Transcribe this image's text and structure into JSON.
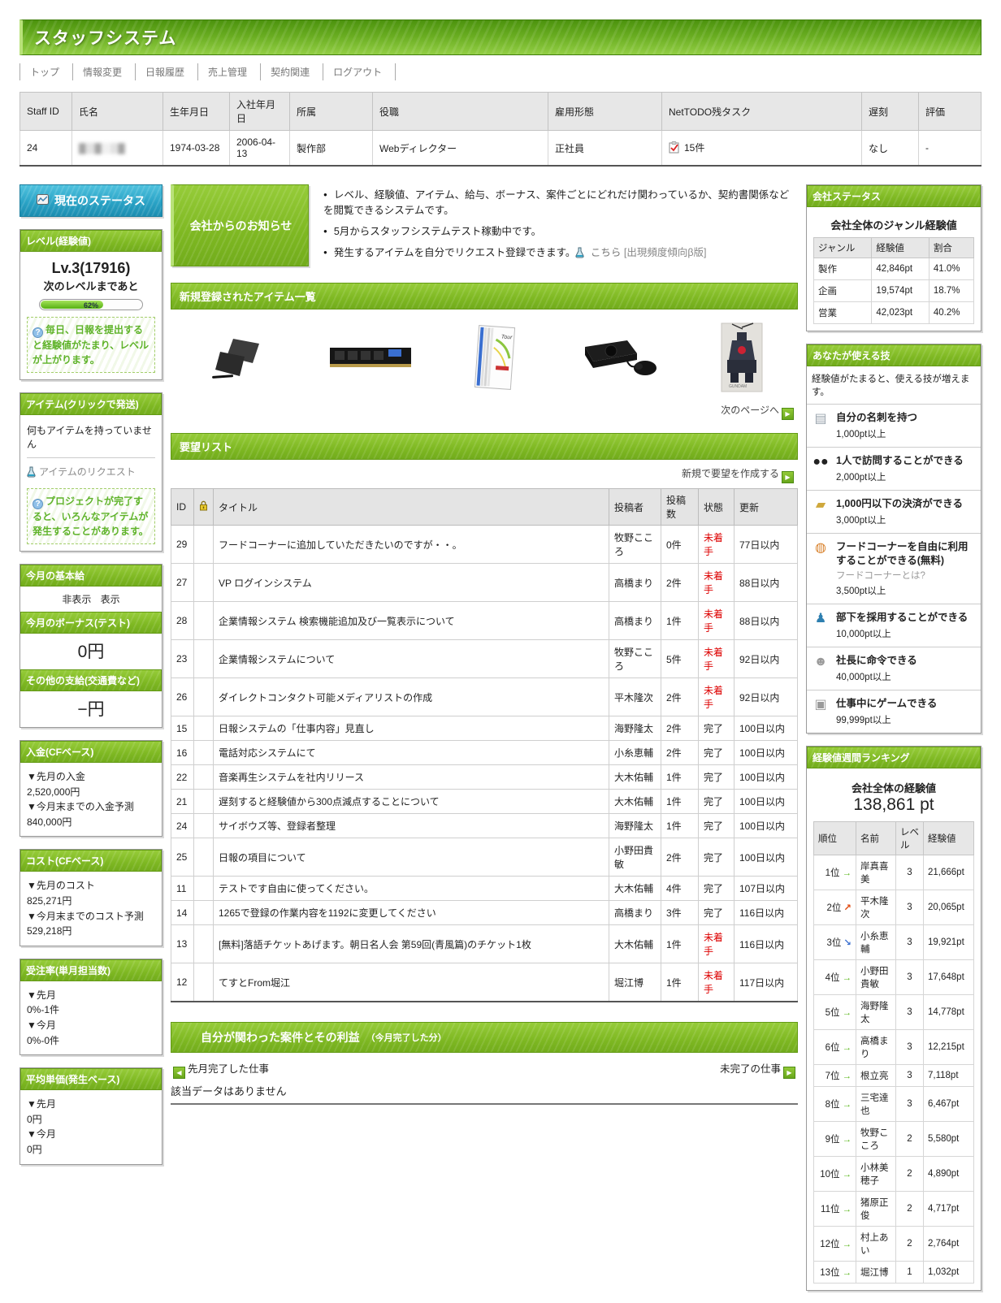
{
  "colors": {
    "accent_green": "#7eb822",
    "accent_blue": "#2aa3c6",
    "alert_red": "#dd0000"
  },
  "header": {
    "title": "スタッフシステム"
  },
  "nav": {
    "items": [
      "トップ",
      "情報変更",
      "日報履歴",
      "売上管理",
      "契約関連",
      "ログアウト"
    ]
  },
  "staff": {
    "headers": [
      "Staff ID",
      "氏名",
      "生年月日",
      "入社年月日",
      "所属",
      "役職",
      "雇用形態",
      "NetTODO残タスク",
      "遅刻",
      "評価"
    ],
    "row": {
      "staff_id": "24",
      "name_censored": "▓▒▓░▒▓",
      "birth": "1974-03-28",
      "join": "2006-04-13",
      "dept": "製作部",
      "role": "Webディレクター",
      "employment": "正社員",
      "nettodo": "15件",
      "late": "なし",
      "rating": "-"
    }
  },
  "status_button": {
    "label": "現在のステータス"
  },
  "level_box": {
    "title": "レベル(経験値)",
    "level": "Lv.3(17916)",
    "next_label": "次のレベルまであと",
    "progress_percent": 62,
    "progress_label": "62%",
    "hint": "毎日、日報を提出すると経験値がたまり、レベルが上がります。"
  },
  "item_box": {
    "title": "アイテム(クリックで発送)",
    "empty": "何もアイテムを持っていません",
    "request_link": "アイテムのリクエスト",
    "hint": "プロジェクトが完了すると、いろんなアイテムが発生することがあります。"
  },
  "salary_box": {
    "base_title": "今月の基本給",
    "hide_label": "非表示",
    "show_label": "表示",
    "bonus_title": "今月のボーナス(テスト)",
    "bonus_value": "0円",
    "other_title": "その他の支給(交通費など)",
    "other_value": "−円"
  },
  "income_box": {
    "title": "入金(CFベース)",
    "lines": [
      {
        "label": "▼先月の入金",
        "value": "2,520,000円"
      },
      {
        "label": "▼今月末までの入金予測",
        "value": "840,000円"
      }
    ]
  },
  "cost_box": {
    "title": "コスト(CFベース)",
    "lines": [
      {
        "label": "▼先月のコスト",
        "value": "825,271円"
      },
      {
        "label": "▼今月末までのコスト予測",
        "value": "529,218円"
      }
    ]
  },
  "order_box": {
    "title": "受注率(単月担当数)",
    "lines": [
      {
        "label": "▼先月",
        "value": "0%-1件"
      },
      {
        "label": "▼今月",
        "value": "0%-0件"
      }
    ]
  },
  "avg_box": {
    "title": "平均単価(発生ベース)",
    "lines": [
      {
        "label": "▼先月",
        "value": "0円"
      },
      {
        "label": "▼今月",
        "value": "0円"
      }
    ]
  },
  "announcements": {
    "button_label": "会社からのお知らせ",
    "items": [
      {
        "text": "レベル、経験値、アイテム、給与、ボーナス、案件ごとにどれだけ関わっているか、契約書関係などを閲覧できるシステムです。"
      },
      {
        "text": "5月からスタッフシステムテスト稼動中です。"
      },
      {
        "text": "発生するアイテムを自分でリクエスト登録できます。",
        "has_flask": true,
        "link": "こちら",
        "suffix": "[出現頻度傾向β版]"
      }
    ]
  },
  "new_items": {
    "title": "新規登録されたアイテム一覧",
    "images": [
      "pen-tablet",
      "memory-module",
      "dvd-boxset",
      "game-console",
      "robot-model"
    ],
    "next_label": "次のページへ"
  },
  "wishlist": {
    "title": "要望リスト",
    "create_label": "新規で要望を作成する",
    "headers": {
      "id": "ID",
      "title": "タイトル",
      "poster": "投稿者",
      "posts": "投稿数",
      "status": "状態",
      "due": "更新"
    },
    "rows": [
      {
        "id": "29",
        "title": "フードコーナーに追加していただきたいのですが・・。",
        "poster": "牧野こころ",
        "posts": "0件",
        "status": "未着手",
        "status_class": "red",
        "due": "77日以内"
      },
      {
        "id": "27",
        "title": "VP ログインシステム",
        "poster": "高橋まり",
        "posts": "2件",
        "status": "未着手",
        "status_class": "red",
        "due": "88日以内"
      },
      {
        "id": "28",
        "title": "企業情報システム 検索機能追加及び一覧表示について",
        "poster": "高橋まり",
        "posts": "1件",
        "status": "未着手",
        "status_class": "red",
        "due": "88日以内"
      },
      {
        "id": "23",
        "title": "企業情報システムについて",
        "poster": "牧野こころ",
        "posts": "5件",
        "status": "未着手",
        "status_class": "red",
        "due": "92日以内"
      },
      {
        "id": "26",
        "title": "ダイレクトコンタクト可能メディアリストの作成",
        "poster": "平木隆次",
        "posts": "2件",
        "status": "未着手",
        "status_class": "red",
        "due": "92日以内"
      },
      {
        "id": "15",
        "title": "日報システムの「仕事内容」見直し",
        "poster": "海野隆太",
        "posts": "2件",
        "status": "完了",
        "status_class": "ok",
        "due": "100日以内"
      },
      {
        "id": "16",
        "title": "電話対応システムにて",
        "poster": "小糸恵輔",
        "posts": "2件",
        "status": "完了",
        "status_class": "ok",
        "due": "100日以内"
      },
      {
        "id": "22",
        "title": "音楽再生システムを社内リリース",
        "poster": "大木佑輔",
        "posts": "1件",
        "status": "完了",
        "status_class": "ok",
        "due": "100日以内"
      },
      {
        "id": "21",
        "title": "遅刻すると経験値から300点減点することについて",
        "poster": "大木佑輔",
        "posts": "1件",
        "status": "完了",
        "status_class": "ok",
        "due": "100日以内"
      },
      {
        "id": "24",
        "title": "サイボウズ等、登録者整理",
        "poster": "海野隆太",
        "posts": "1件",
        "status": "完了",
        "status_class": "ok",
        "due": "100日以内"
      },
      {
        "id": "25",
        "title": "日報の項目について",
        "poster": "小野田貴敏",
        "posts": "2件",
        "status": "完了",
        "status_class": "ok",
        "due": "100日以内"
      },
      {
        "id": "11",
        "title": "テストです自由に使ってください。",
        "poster": "大木佑輔",
        "posts": "4件",
        "status": "完了",
        "status_class": "ok",
        "due": "107日以内"
      },
      {
        "id": "14",
        "title": "1265で登録の作業内容を1192に変更してください",
        "poster": "高橋まり",
        "posts": "3件",
        "status": "完了",
        "status_class": "ok",
        "due": "116日以内"
      },
      {
        "id": "13",
        "title": "[無料]落語チケットあげます。朝日名人会 第59回(青風篇)のチケット1枚",
        "poster": "大木佑輔",
        "posts": "1件",
        "status": "未着手",
        "status_class": "red",
        "due": "116日以内"
      },
      {
        "id": "12",
        "title": "てすとFrom堀江",
        "poster": "堀江博",
        "posts": "1件",
        "status": "未着手",
        "status_class": "red",
        "due": "117日以内"
      }
    ]
  },
  "projects": {
    "title": "自分が関わった案件とその利益",
    "subtitle": "（今月完了した分）",
    "prev_label": "先月完了した仕事",
    "next_label": "未完了の仕事",
    "empty": "該当データはありません"
  },
  "company_status": {
    "title": "会社ステータス",
    "subtitle": "会社全体のジャンル経験値",
    "headers": [
      "ジャンル",
      "経験値",
      "割合"
    ],
    "rows": [
      {
        "genre": "製作",
        "exp": "42,846pt",
        "share": "41.0%"
      },
      {
        "genre": "企画",
        "exp": "19,574pt",
        "share": "18.7%"
      },
      {
        "genre": "営業",
        "exp": "42,023pt",
        "share": "40.2%"
      }
    ]
  },
  "skills": {
    "title": "あなたが使える技",
    "note": "経験値がたまると、使える技が増えます。",
    "items": [
      {
        "icon": "name-card-icon",
        "icon_glyph": "▤",
        "title": "自分の名刺を持つ",
        "req": "1,000pt以上"
      },
      {
        "icon": "binoculars-icon",
        "icon_glyph": "●●",
        "title": "1人で訪問することができる",
        "req": "2,000pt以上"
      },
      {
        "icon": "payment-card-icon",
        "icon_glyph": "▰",
        "title": "1,000円以下の決済ができる",
        "req": "3,000pt以上"
      },
      {
        "icon": "food-icon",
        "icon_glyph": "◍",
        "title": "フードコーナーを自由に利用することができる(無料)",
        "link": "フードコーナーとは?",
        "req": "3,500pt以上"
      },
      {
        "icon": "recruit-icon",
        "icon_glyph": "♟",
        "title": "部下を採用することができる",
        "req": "10,000pt以上"
      },
      {
        "icon": "president-icon",
        "icon_glyph": "☻",
        "title": "社長に命令できる",
        "req": "40,000pt以上"
      },
      {
        "icon": "game-icon",
        "icon_glyph": "▣",
        "title": "仕事中にゲームできる",
        "req": "99,999pt以上"
      }
    ]
  },
  "ranking": {
    "title": "経験値週間ランキング",
    "total_label": "会社全体の経験値",
    "total_value": "138,861 pt",
    "headers": [
      "順位",
      "名前",
      "レベル",
      "経験値"
    ],
    "rows": [
      {
        "rank": "1位",
        "trend": "same",
        "trend_glyph": "→",
        "name": "岸真喜美",
        "level": "3",
        "exp": "21,666pt"
      },
      {
        "rank": "2位",
        "trend": "up",
        "trend_glyph": "↗",
        "name": "平木隆次",
        "level": "3",
        "exp": "20,065pt"
      },
      {
        "rank": "3位",
        "trend": "down",
        "trend_glyph": "↘",
        "name": "小糸恵輔",
        "level": "3",
        "exp": "19,921pt"
      },
      {
        "rank": "4位",
        "trend": "same",
        "trend_glyph": "→",
        "name": "小野田貴敏",
        "level": "3",
        "exp": "17,648pt"
      },
      {
        "rank": "5位",
        "trend": "same",
        "trend_glyph": "→",
        "name": "海野隆太",
        "level": "3",
        "exp": "14,778pt"
      },
      {
        "rank": "6位",
        "trend": "same",
        "trend_glyph": "→",
        "name": "高橋まり",
        "level": "3",
        "exp": "12,215pt"
      },
      {
        "rank": "7位",
        "trend": "same",
        "trend_glyph": "→",
        "name": "根立亮",
        "level": "3",
        "exp": "7,118pt"
      },
      {
        "rank": "8位",
        "trend": "same",
        "trend_glyph": "→",
        "name": "三宅達也",
        "level": "3",
        "exp": "6,467pt"
      },
      {
        "rank": "9位",
        "trend": "same",
        "trend_glyph": "→",
        "name": "牧野こころ",
        "level": "2",
        "exp": "5,580pt"
      },
      {
        "rank": "10位",
        "trend": "same",
        "trend_glyph": "→",
        "name": "小林美穂子",
        "level": "2",
        "exp": "4,890pt"
      },
      {
        "rank": "11位",
        "trend": "same",
        "trend_glyph": "→",
        "name": "猪原正俊",
        "level": "2",
        "exp": "4,717pt"
      },
      {
        "rank": "12位",
        "trend": "same",
        "trend_glyph": "→",
        "name": "村上あい",
        "level": "2",
        "exp": "2,764pt"
      },
      {
        "rank": "13位",
        "trend": "same",
        "trend_glyph": "→",
        "name": "堀江博",
        "level": "1",
        "exp": "1,032pt"
      }
    ]
  }
}
